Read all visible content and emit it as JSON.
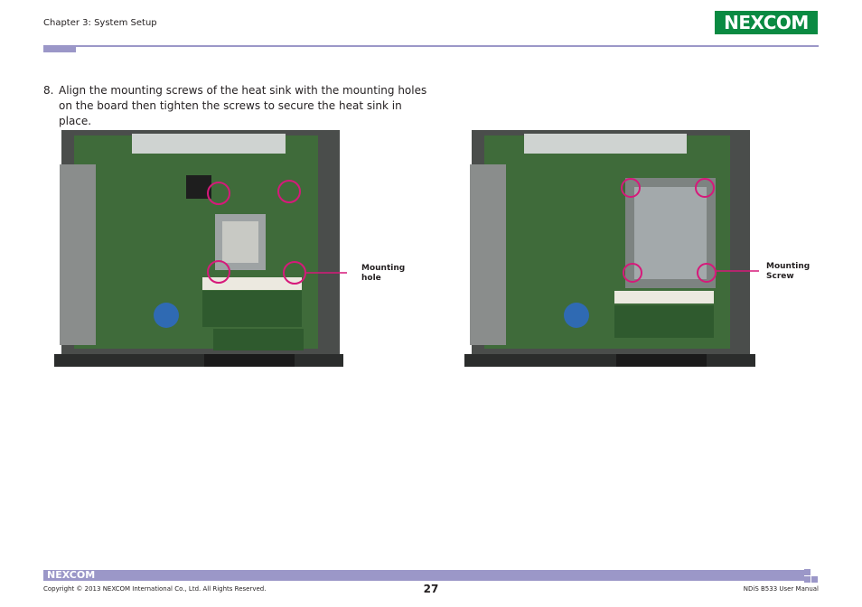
{
  "header": {
    "chapter": "Chapter 3: System Setup",
    "logo_text": "NEXCOM"
  },
  "step": {
    "number": "8.",
    "text": "Align the mounting screws of the heat sink with the mounting holes on the board then tighten the screws to secure the heat sink in place."
  },
  "figures": {
    "left_label": "Mounting hole",
    "right_label": "Mounting Screw"
  },
  "footer": {
    "logo_text": "NEXCOM",
    "copyright": "Copyright © 2013 NEXCOM International Co., Ltd. All Rights Reserved.",
    "page_number": "27",
    "manual": "NDiS B533 User Manual"
  },
  "colors": {
    "accent": "#9b97c8",
    "brand_green": "#0a8a42",
    "highlight": "#d6197a",
    "pcb_green": "#3f6b3a"
  }
}
